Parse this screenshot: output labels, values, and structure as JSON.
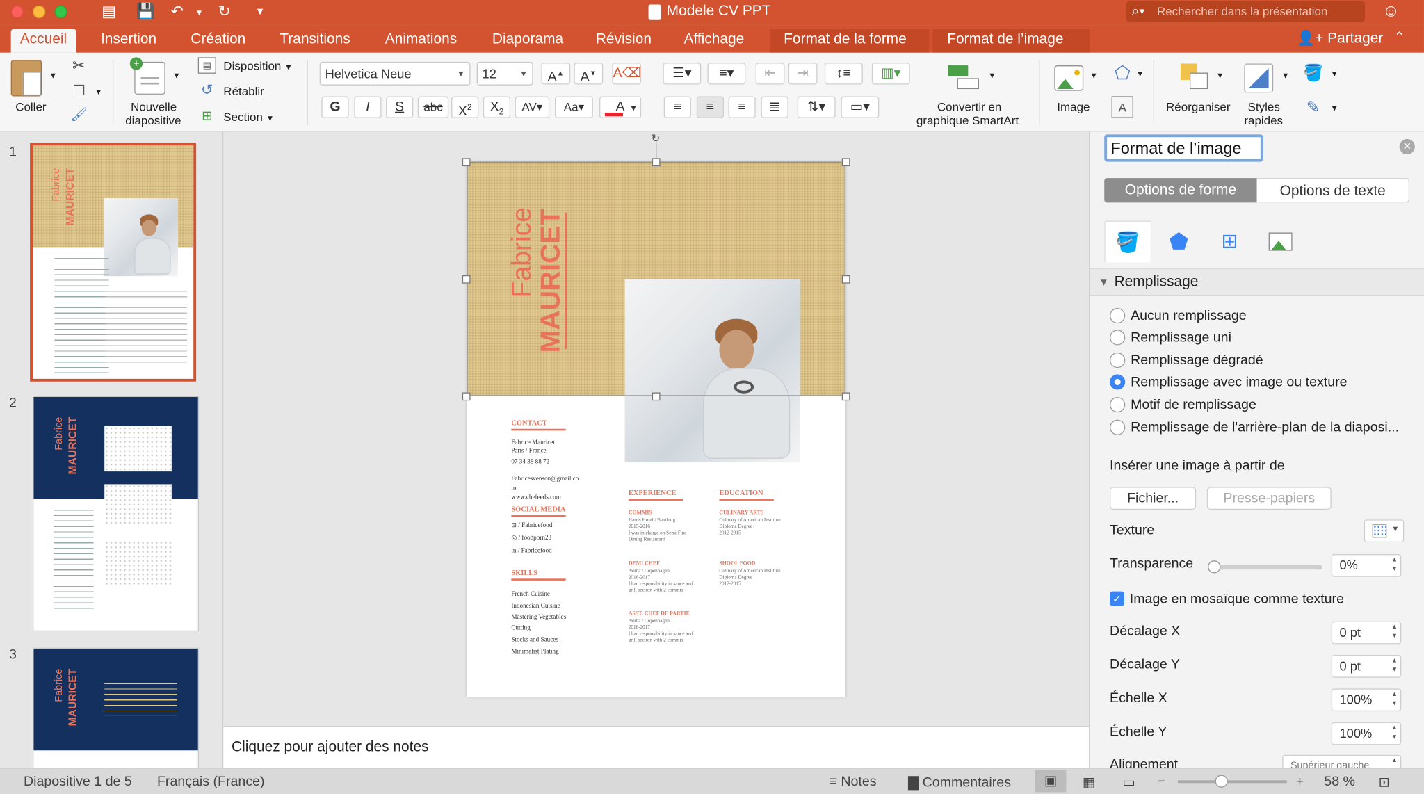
{
  "window": {
    "title": "Modele CV PPT"
  },
  "search": {
    "placeholder": "Rechercher dans la présentation"
  },
  "tabs": [
    "Accueil",
    "Insertion",
    "Création",
    "Transitions",
    "Animations",
    "Diaporama",
    "Révision",
    "Affichage",
    "Format de la forme",
    "Format de l’image"
  ],
  "share_label": "Partager",
  "ribbon": {
    "paste_label": "Coller",
    "new_slide_label": [
      "Nouvelle",
      "diapositive"
    ],
    "layout_label": "Disposition",
    "reset_label": "Rétablir",
    "section_label": "Section",
    "font_name": "Helvetica Neue",
    "font_size": "12",
    "bold": "G",
    "italic": "I",
    "underline": "S",
    "strike": "abc",
    "superscript": "X",
    "subscript": "X",
    "smartart_label": [
      "Convertir en",
      "graphique SmartArt"
    ],
    "image_label": "Image",
    "arrange_label": "Réorganiser",
    "styles_label": [
      "Styles",
      "rapides"
    ],
    "font_color": "#e8262b"
  },
  "slides": [
    {
      "number": "1",
      "name_first": "Fabrice",
      "name_last": "MAURICET"
    },
    {
      "number": "2",
      "name_first": "Fabrice",
      "name_last": "MAURICET"
    },
    {
      "number": "3",
      "name_first": "Fabrice",
      "name_last": "MAURICET"
    }
  ],
  "slide_content": {
    "name_first": "Fabrice",
    "name_last": "MAURICET",
    "contact_heading": "CONTACT",
    "contact_lines": [
      "Fabrice Mauricet",
      "Paris / France",
      "07 34 38 88 72"
    ],
    "email_lines": [
      "Fabricesvenson@gmail.co",
      "m",
      "www.chefeeds.com"
    ],
    "social_heading": "SOCIAL MEDIA",
    "social_lines": [
      "/ Fabricefood",
      "/ foodporn23",
      "/ Fabricefood"
    ],
    "skills_heading": "SKILLS",
    "skills": [
      "French Cuisine",
      "Indonesian Cuisine",
      "Mastering Vegetables",
      "Cutting",
      "Stocks and Sauces",
      "Minimalist Plating"
    ],
    "experience_heading": "EXPERIENCE",
    "experience": [
      {
        "title": "COMMIS",
        "lines": [
          "Harris Hotel / Bandung",
          "2015-2016",
          "I was in charge on Semi Fine",
          "Dining Restaurant"
        ]
      },
      {
        "title": "DEMI CHEF",
        "lines": [
          "Noma / Copenhagen",
          "2016-2017",
          "I had responsibility in sauce and",
          "grill section with 2 commis"
        ]
      },
      {
        "title": "ASST. CHEF DE PARTIE",
        "lines": [
          "Noma / Copenhagen",
          "2016-2017",
          "I had responsibility in sauce and",
          "grill section with 2 commis"
        ]
      }
    ],
    "education_heading": "EDUCATION",
    "education": [
      {
        "title": "CULINARY ARTS",
        "lines": [
          "Culinary of American Institute",
          "Diploma Degree",
          "2012-2015"
        ]
      },
      {
        "title": "SHOOL FOOD",
        "lines": [
          "Culinary of American Institute",
          "Diploma Degree",
          "2012-2015"
        ]
      }
    ]
  },
  "notes_placeholder": "Cliquez pour ajouter des notes",
  "format_panel": {
    "title": "Format de l’image",
    "seg_shape": "Options de forme",
    "seg_text": "Options de texte",
    "section_fill": "Remplissage",
    "fill_options": [
      "Aucun remplissage",
      "Remplissage uni",
      "Remplissage dégradé",
      "Remplissage avec image ou texture",
      "Motif de remplissage",
      "Remplissage de l'arrière-plan de la diaposi..."
    ],
    "selected_fill": "Remplissage avec image ou texture",
    "insert_from_label": "Insérer une image à partir de",
    "file_button": "Fichier...",
    "clipboard_button": "Presse-papiers",
    "texture_label": "Texture",
    "transparency_label": "Transparence",
    "transparency_value": "0%",
    "tile_label": "Image en mosaïque comme texture",
    "tile_checked": true,
    "offset_x_label": "Décalage X",
    "offset_x_value": "0 pt",
    "offset_y_label": "Décalage Y",
    "offset_y_value": "0 pt",
    "scale_x_label": "Échelle X",
    "scale_x_value": "100%",
    "scale_y_label": "Échelle Y",
    "scale_y_value": "100%",
    "alignment_label": "Alignement",
    "alignment_value": "Supérieur gauche"
  },
  "statusbar": {
    "slide_info": "Diapositive 1 de 5",
    "language": "Français (France)",
    "notes": "Notes",
    "comments": "Commentaires",
    "zoom": "58 %",
    "zoom_fraction": 0.58
  },
  "colors": {
    "accent": "#d35230",
    "select_blue": "#3a85f5",
    "resume_accent": "#e8735a",
    "navy": "#13305e"
  }
}
